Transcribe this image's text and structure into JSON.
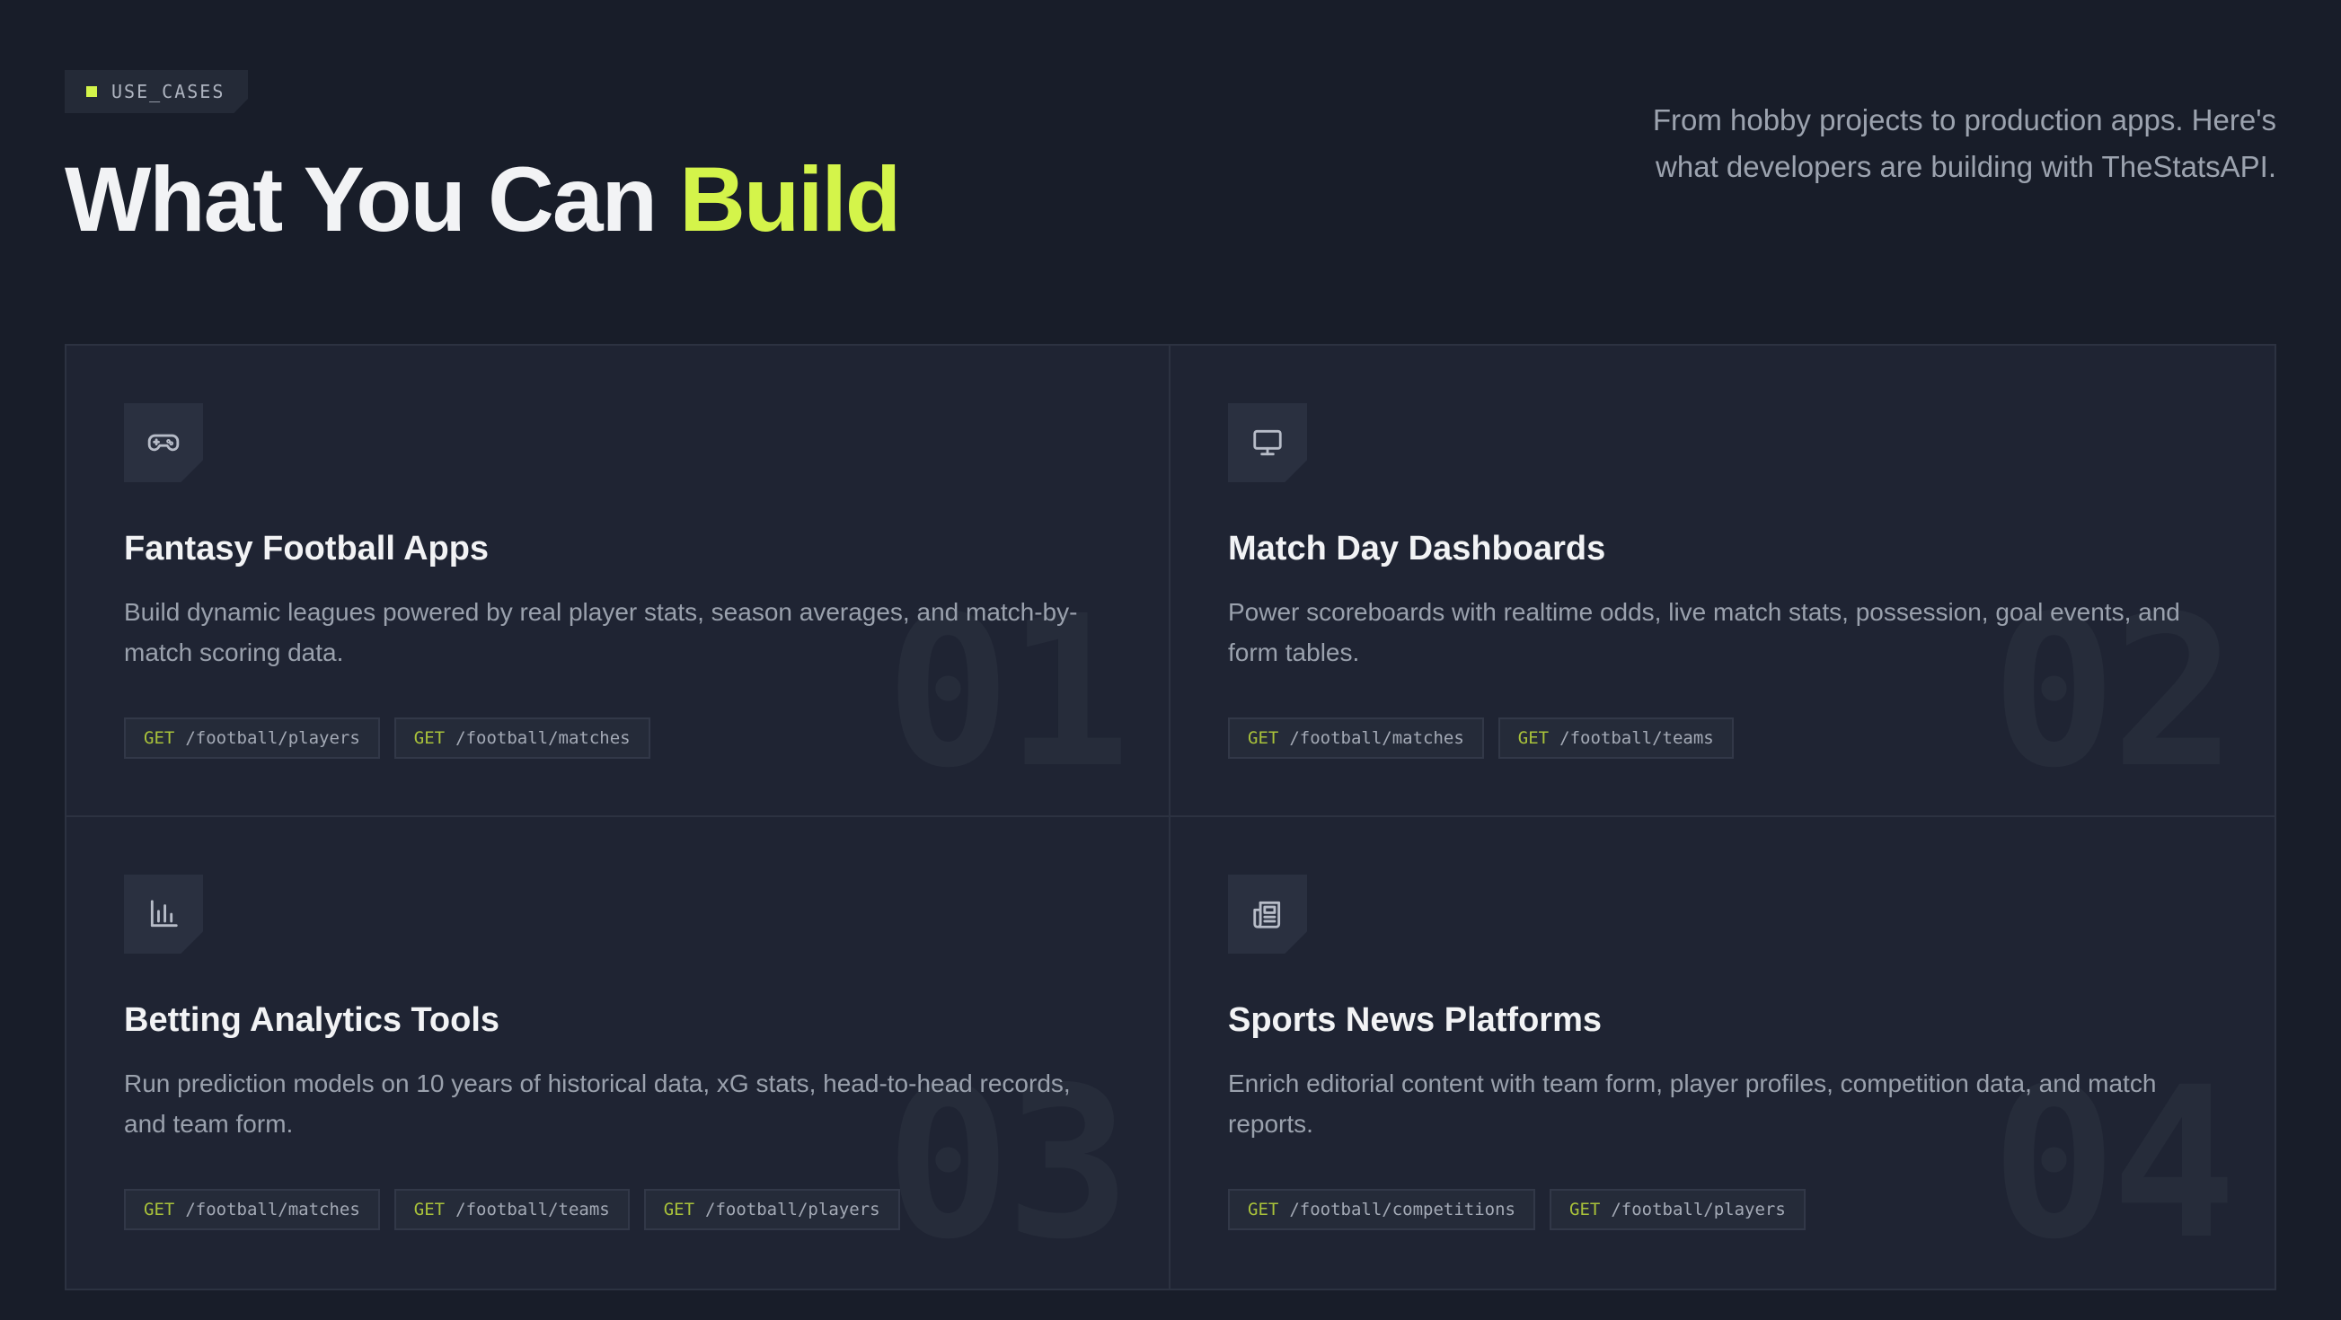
{
  "header": {
    "tag": "USE_CASES",
    "title_main": "What You Can ",
    "title_accent": "Build",
    "subtitle": "From hobby projects to production apps. Here's what developers are building with TheStatsAPI."
  },
  "colors": {
    "background": "#181d29",
    "card": "#1f2433",
    "accent": "#d4f44a",
    "method": "#a9c23a"
  },
  "cards": [
    {
      "icon": "gamepad-icon",
      "title": "Fantasy Football Apps",
      "description": "Build dynamic leagues powered by real player stats, season averages, and match-by-match scoring data.",
      "number": "01",
      "endpoints": [
        {
          "method": "GET",
          "path": "/football/players"
        },
        {
          "method": "GET",
          "path": "/football/matches"
        }
      ]
    },
    {
      "icon": "monitor-icon",
      "title": "Match Day Dashboards",
      "description": "Power scoreboards with realtime odds, live match stats, possession, goal events, and form tables.",
      "number": "02",
      "endpoints": [
        {
          "method": "GET",
          "path": "/football/matches"
        },
        {
          "method": "GET",
          "path": "/football/teams"
        }
      ]
    },
    {
      "icon": "bar-chart-icon",
      "title": "Betting Analytics Tools",
      "description": "Run prediction models on 10 years of historical data, xG stats, head-to-head records, and team form.",
      "number": "03",
      "endpoints": [
        {
          "method": "GET",
          "path": "/football/matches"
        },
        {
          "method": "GET",
          "path": "/football/teams"
        },
        {
          "method": "GET",
          "path": "/football/players"
        }
      ]
    },
    {
      "icon": "newspaper-icon",
      "title": "Sports News Platforms",
      "description": "Enrich editorial content with team form, player profiles, competition data, and match reports.",
      "number": "04",
      "endpoints": [
        {
          "method": "GET",
          "path": "/football/competitions"
        },
        {
          "method": "GET",
          "path": "/football/players"
        }
      ]
    }
  ]
}
